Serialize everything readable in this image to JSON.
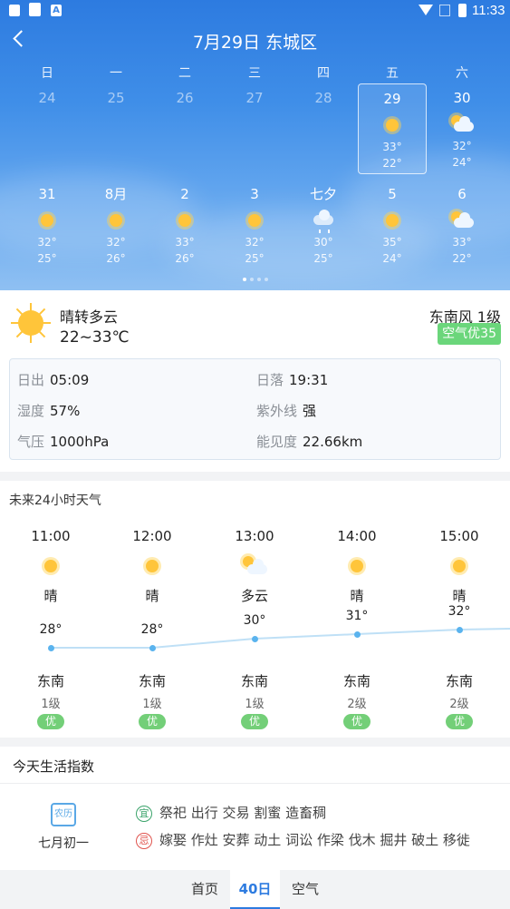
{
  "status_bar": {
    "time": "11:33",
    "icons": [
      "notification-icon",
      "sim-icon",
      "app-a-icon",
      "wifi-icon",
      "no-signal-icon",
      "battery-icon"
    ],
    "badge_letter": "A"
  },
  "header": {
    "title": "7月29日 东城区",
    "weekdays": [
      "日",
      "一",
      "二",
      "三",
      "四",
      "五",
      "六"
    ],
    "week1": [
      {
        "day": "24",
        "past": true
      },
      {
        "day": "25",
        "past": true
      },
      {
        "day": "26",
        "past": true
      },
      {
        "day": "27",
        "past": true
      },
      {
        "day": "28",
        "past": true
      },
      {
        "day": "29",
        "icon": "sunny-icon",
        "hi": "33°",
        "lo": "22°",
        "selected": true
      },
      {
        "day": "30",
        "icon": "partly-cloudy-icon",
        "hi": "32°",
        "lo": "24°"
      }
    ],
    "week2": [
      {
        "day": "31",
        "icon": "sunny-icon",
        "hi": "32°",
        "lo": "25°"
      },
      {
        "day": "8月",
        "icon": "sunny-icon",
        "hi": "32°",
        "lo": "26°"
      },
      {
        "day": "2",
        "icon": "sunny-icon",
        "hi": "33°",
        "lo": "26°"
      },
      {
        "day": "3",
        "icon": "sunny-icon",
        "hi": "32°",
        "lo": "25°"
      },
      {
        "day": "七夕",
        "icon": "rain-icon",
        "hi": "30°",
        "lo": "25°"
      },
      {
        "day": "5",
        "icon": "sunny-icon",
        "hi": "35°",
        "lo": "24°"
      },
      {
        "day": "6",
        "icon": "partly-cloudy-icon",
        "hi": "33°",
        "lo": "22°"
      }
    ],
    "page_index": 0,
    "page_count": 4
  },
  "today": {
    "icon": "sunny-icon",
    "condition": "晴转多云",
    "temp_range": "22~33℃",
    "wind": "东南风 1级",
    "air_quality": "空气优35",
    "details": {
      "sunrise_label": "日出",
      "sunrise": "05:09",
      "sunset_label": "日落",
      "sunset": "19:31",
      "humidity_label": "湿度",
      "humidity": "57%",
      "uv_label": "紫外线",
      "uv": "强",
      "pressure_label": "气压",
      "pressure": "1000hPa",
      "visibility_label": "能见度",
      "visibility": "22.66km"
    }
  },
  "hourly": {
    "title": "未来24小时天气",
    "items": [
      {
        "time": "11:00",
        "icon": "sunny-icon",
        "cond": "晴",
        "temp": "28°",
        "wind_dir": "东南",
        "wind_level": "1级",
        "aqi": "优"
      },
      {
        "time": "12:00",
        "icon": "sunny-icon",
        "cond": "晴",
        "temp": "28°",
        "wind_dir": "东南",
        "wind_level": "1级",
        "aqi": "优"
      },
      {
        "time": "13:00",
        "icon": "partly-cloudy-icon",
        "cond": "多云",
        "temp": "30°",
        "wind_dir": "东南",
        "wind_level": "1级",
        "aqi": "优"
      },
      {
        "time": "14:00",
        "icon": "sunny-icon",
        "cond": "晴",
        "temp": "31°",
        "wind_dir": "东南",
        "wind_level": "2级",
        "aqi": "优"
      },
      {
        "time": "15:00",
        "icon": "sunny-icon",
        "cond": "晴",
        "temp": "32°",
        "wind_dir": "东南",
        "wind_level": "2级",
        "aqi": "优"
      }
    ]
  },
  "life": {
    "title": "今天生活指数",
    "calendar_label": "农历",
    "lunar_date": "七月初一",
    "yi_badge": "宜",
    "yi": "祭祀 出行 交易 割蜜 造畜稠",
    "ji_badge": "忌",
    "ji": "嫁娶 作灶 安葬 动土 词讼 作梁 伐木 掘井 破土 移徙"
  },
  "tabs": [
    {
      "label": "首页",
      "active": false
    },
    {
      "label": "40日",
      "active": true
    },
    {
      "label": "空气",
      "active": false
    }
  ],
  "colors": {
    "accent": "#2d7be0",
    "air_good": "#6bd67b",
    "yi": "#3aa36a",
    "ji": "#e0534d"
  }
}
